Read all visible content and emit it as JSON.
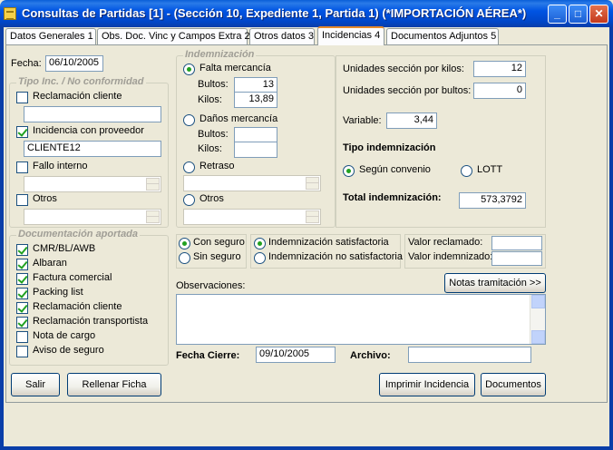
{
  "window": {
    "title": "Consultas de Partidas [1] - (Sección 10, Expediente 1, Partida 1) (*IMPORTACIÓN AÉREA*)",
    "controls": {
      "minimize": "_",
      "maximize": "□",
      "close": "✕"
    }
  },
  "tabs": [
    {
      "label": "Datos Generales 1"
    },
    {
      "label": "Obs. Doc. Vinc y Campos Extra 2"
    },
    {
      "label": "Otros datos 3"
    },
    {
      "label": "Incidencias 4",
      "active": true
    },
    {
      "label": "Documentos Adjuntos 5"
    }
  ],
  "fecha": {
    "label": "Fecha:",
    "value": "06/10/2005"
  },
  "tipo_inc": {
    "title": "Tipo Inc. / No conformidad",
    "reclamacion_cliente": {
      "label": "Reclamación cliente",
      "checked": false,
      "value": ""
    },
    "incidencia_proveedor": {
      "label": "Incidencia con proveedor",
      "checked": true,
      "value": "CLIENTE12"
    },
    "fallo_interno": {
      "label": "Fallo interno",
      "checked": false,
      "value": ""
    },
    "otros": {
      "label": "Otros",
      "checked": false,
      "value": ""
    }
  },
  "indemnizacion": {
    "title": "Indemnización",
    "falta": {
      "label": "Falta mercancía",
      "selected": true,
      "bultos_label": "Bultos:",
      "bultos": "13",
      "kilos_label": "Kilos:",
      "kilos": "13,89"
    },
    "danos": {
      "label": "Daños mercancía",
      "selected": false,
      "bultos_label": "Bultos:",
      "bultos": "",
      "kilos_label": "Kilos:",
      "kilos": ""
    },
    "retraso": {
      "label": "Retraso",
      "selected": false,
      "value": ""
    },
    "otros": {
      "label": "Otros",
      "selected": false,
      "value": ""
    }
  },
  "unidades": {
    "kilos_label": "Unidades sección por kilos:",
    "kilos": "12",
    "bultos_label": "Unidades sección por bultos:",
    "bultos": "0",
    "variable_label": "Variable:",
    "variable": "3,44",
    "tipo_label": "Tipo indemnización",
    "segun_convenio": "Según convenio",
    "lott": "LOTT",
    "tipo_selected": "segun_convenio",
    "total_label": "Total indemnización:",
    "total": "573,3792"
  },
  "documentacion": {
    "title": "Documentación aportada",
    "items": [
      {
        "label": "CMR/BL/AWB",
        "checked": true
      },
      {
        "label": "Albaran",
        "checked": true
      },
      {
        "label": "Factura comercial",
        "checked": true
      },
      {
        "label": "Packing list",
        "checked": true
      },
      {
        "label": "Reclamación cliente",
        "checked": true
      },
      {
        "label": "Reclamación transportista",
        "checked": true
      },
      {
        "label": "Nota de cargo",
        "checked": false
      },
      {
        "label": "Aviso de seguro",
        "checked": false
      }
    ]
  },
  "seguro": {
    "con": "Con seguro",
    "sin": "Sin seguro",
    "selected": "con"
  },
  "satisfaccion": {
    "si": "Indemnización satisfactoria",
    "no": "Indemnización no satisfactoria",
    "selected": "si"
  },
  "valores": {
    "reclamado_label": "Valor reclamado:",
    "reclamado": "",
    "indemnizado_label": "Valor indemnizado:",
    "indemnizado": ""
  },
  "notas_button": "Notas tramitación >>",
  "observaciones": {
    "label": "Observaciones:",
    "value": ""
  },
  "fecha_cierre": {
    "label": "Fecha Cierre:",
    "value": "09/10/2005"
  },
  "archivo": {
    "label": "Archivo:",
    "value": ""
  },
  "buttons": {
    "salir": "Salir",
    "rellenar": "Rellenar Ficha",
    "imprimir": "Imprimir Incidencia",
    "documentos": "Documentos"
  }
}
